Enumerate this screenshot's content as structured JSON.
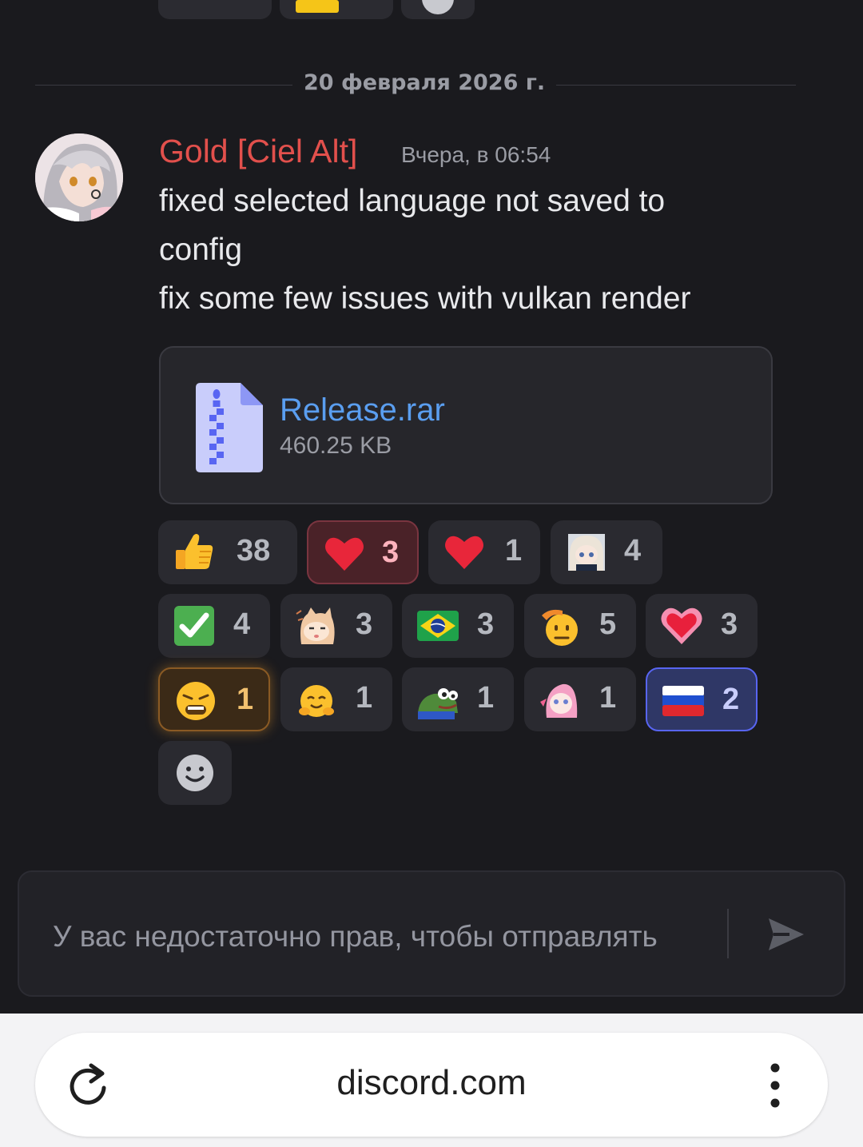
{
  "date_divider": "20 февраля 2026 г.",
  "message": {
    "author": "Gold [Ciel Alt]",
    "timestamp": "Вчера, в 06:54",
    "lines": [
      "fixed selected language not saved to",
      "config",
      "fix some few issues with vulkan render"
    ]
  },
  "attachment": {
    "name": "Release.rar",
    "size": "460.25 KB",
    "icon": "zip-file-icon"
  },
  "reactions": [
    {
      "emoji": "thumbs-up",
      "count": "38"
    },
    {
      "emoji": "red-heart",
      "count": "3",
      "selected": true
    },
    {
      "emoji": "red-heart",
      "count": "1"
    },
    {
      "emoji": "anime-girl-sticker",
      "count": "4"
    },
    {
      "emoji": "check-mark",
      "count": "4"
    },
    {
      "emoji": "cat-peek",
      "count": "3"
    },
    {
      "emoji": "flag-brazil",
      "count": "3"
    },
    {
      "emoji": "saluting-face",
      "count": "5"
    },
    {
      "emoji": "pink-heart",
      "count": "3"
    },
    {
      "emoji": "weary-face",
      "count": "1",
      "selected": true
    },
    {
      "emoji": "smiling-hands-face",
      "count": "1"
    },
    {
      "emoji": "pepe-frog",
      "count": "1"
    },
    {
      "emoji": "pink-hair-girl",
      "count": "1"
    },
    {
      "emoji": "flag-russia",
      "count": "2",
      "selected": true
    }
  ],
  "composer": {
    "placeholder": "У вас недостаточно прав, чтобы отправлять",
    "send_icon": "send-icon"
  },
  "browser": {
    "url": "discord.com",
    "reload_icon": "reload-icon",
    "menu_icon": "more-vertical-icon"
  },
  "colors": {
    "background": "#1a1a1e",
    "author": "#e2504c",
    "link": "#5a9ef0",
    "accent": "#5865f2"
  }
}
